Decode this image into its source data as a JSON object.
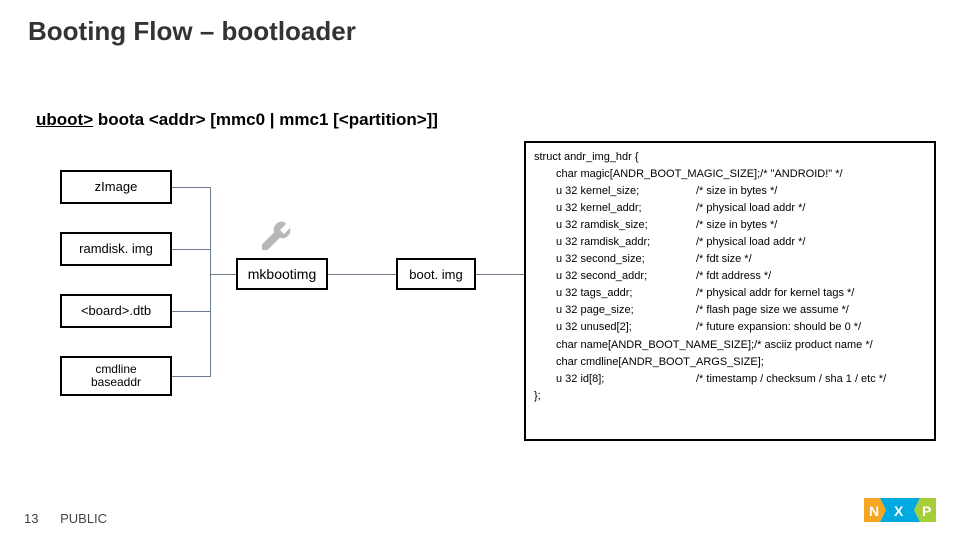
{
  "title": "Booting Flow – bootloader",
  "cmd": {
    "prompt": "uboot>",
    "rest": " boota <addr> [mmc0 | mmc1 [<partition>]]"
  },
  "inputs": {
    "zimage": "zImage",
    "ramdisk": "ramdisk. img",
    "board": "<board>.dtb",
    "cmdline": "cmdline\nbaseaddr"
  },
  "tool": "mkbootimg",
  "bootimg": "boot. img",
  "struct": {
    "open": "struct andr_img_hdr {",
    "lines": [
      {
        "f": "char magic[ANDR_BOOT_MAGIC_SIZE];",
        "c": "/* \"ANDROID!\" */"
      },
      {
        "f": "u 32 kernel_size;",
        "c": "/* size in bytes */"
      },
      {
        "f": "u 32 kernel_addr;",
        "c": "/* physical load addr */"
      },
      {
        "f": "u 32 ramdisk_size;",
        "c": "/* size in bytes */"
      },
      {
        "f": "u 32 ramdisk_addr;",
        "c": "/* physical load addr */"
      },
      {
        "f": "u 32 second_size;",
        "c": "/* fdt size */"
      },
      {
        "f": "u 32 second_addr;",
        "c": "/* fdt address */"
      },
      {
        "f": "u 32 tags_addr;",
        "c": "/* physical addr for kernel tags */"
      },
      {
        "f": "u 32 page_size;",
        "c": "/* flash page size we assume */"
      },
      {
        "f": "u 32 unused[2];",
        "c": "/* future expansion: should be 0 */"
      },
      {
        "f": "char name[ANDR_BOOT_NAME_SIZE];",
        "c": "/* asciiz product name */",
        "wrap": true
      },
      {
        "f": "char cmdline[ANDR_BOOT_ARGS_SIZE];",
        "c": ""
      },
      {
        "f": "u 32 id[8];",
        "c": "/* timestamp / checksum / sha 1 / etc */"
      }
    ],
    "close": "};"
  },
  "footer": {
    "page": "13",
    "label": "PUBLIC"
  },
  "colors": {
    "accent": "#F5A623",
    "logo_blue": "#00A9E0",
    "logo_yellow": "#FDB813",
    "logo_green": "#A6CE39"
  }
}
